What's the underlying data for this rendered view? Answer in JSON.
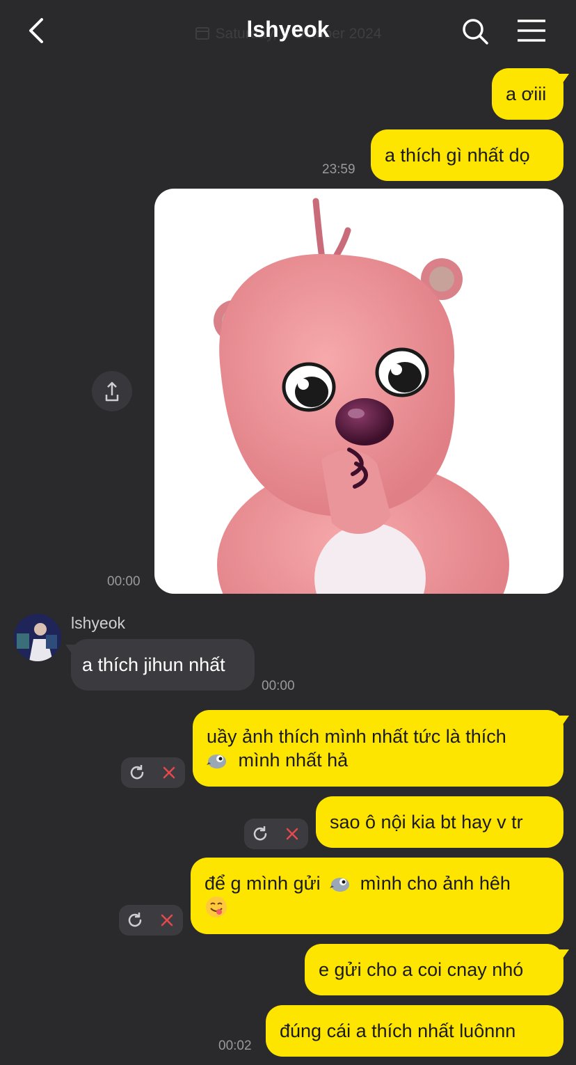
{
  "header": {
    "title": "lshyeok",
    "date": "Saturday, 5 October 2024"
  },
  "messages": [
    {
      "id": "m1",
      "text": "a ơiii"
    },
    {
      "id": "m2",
      "text": "a thích gì nhất dọ",
      "time": "23:59"
    },
    {
      "id": "m3",
      "type": "image",
      "time": "00:00"
    },
    {
      "id": "m4",
      "sender": "lshyeok",
      "text": "a thích jihun nhất",
      "time": "00:00"
    },
    {
      "id": "m5",
      "line1": "uầy ảnh thích mình nhất tức là thích",
      "line2": "mình nhất hả",
      "failed": true
    },
    {
      "id": "m6",
      "text": "sao ô nội kia bt hay v tr",
      "failed": true
    },
    {
      "id": "m7",
      "line1a": "để g mình gửi",
      "line1b": "mình cho ảnh hêh",
      "failed": true
    },
    {
      "id": "m8",
      "text": "e gửi cho a coi cnay nhó"
    },
    {
      "id": "m9",
      "text": "đúng cái a thích nhất luônnn",
      "time": "00:02"
    }
  ],
  "colors": {
    "background": "#2a2a2d",
    "my_bubble": "#fee500",
    "their_bubble": "#3b3b3f",
    "time_text": "#9a9a9e",
    "fail_x": "#e5484d"
  },
  "icons": [
    "back-chevron-icon",
    "calendar-icon",
    "search-icon",
    "menu-icon",
    "share-icon",
    "retry-icon",
    "cancel-icon",
    "bird-emoji-icon",
    "yum-emoji-icon"
  ]
}
